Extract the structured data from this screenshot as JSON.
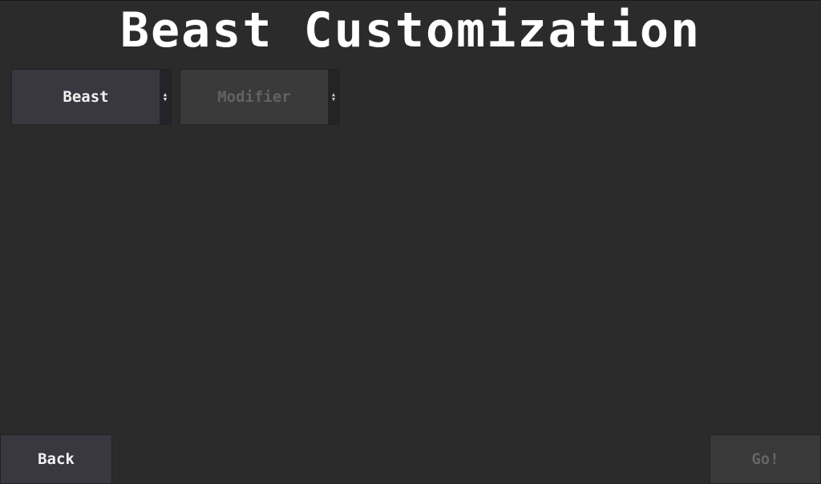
{
  "title": "Beast Customization",
  "selects": {
    "beast": {
      "value": "Beast"
    },
    "modifier": {
      "value": "Modifier"
    }
  },
  "buttons": {
    "back": "Back",
    "go": "Go!"
  },
  "colors": {
    "background": "#2b2b2b",
    "active_button": "#393841",
    "disabled_button": "#393939",
    "disabled_text": "#666666"
  }
}
